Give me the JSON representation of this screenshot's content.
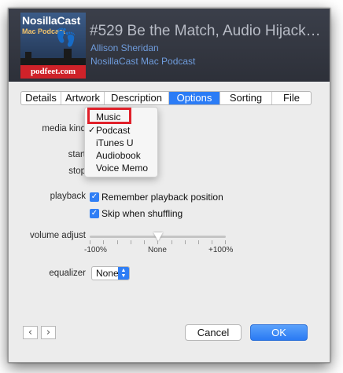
{
  "header": {
    "artwork": {
      "title": "NosillaCast",
      "subtitle": "Mac Podcast",
      "url": "podfeet.com",
      "feet_icon": "footprints"
    },
    "episode_title": "#529 Be the Match, Audio Hijack…",
    "artist": "Allison Sheridan",
    "album": "NosillaCast Mac Podcast"
  },
  "tabs": [
    {
      "label": "Details",
      "selected": false
    },
    {
      "label": "Artwork",
      "selected": false
    },
    {
      "label": "Description",
      "selected": false
    },
    {
      "label": "Options",
      "selected": true
    },
    {
      "label": "Sorting",
      "selected": false
    },
    {
      "label": "File",
      "selected": false
    }
  ],
  "options": {
    "media_kind_label": "media kind",
    "start_label": "start",
    "stop_label": "stop",
    "playback_label": "playback",
    "remember_label": "Remember playback position",
    "remember_checked": true,
    "skip_label": "Skip when shuffling",
    "skip_checked": true,
    "volume_label": "volume adjust",
    "volume_value": 0,
    "volume_min_label": "-100%",
    "volume_mid_label": "None",
    "volume_max_label": "+100%",
    "equalizer_label": "equalizer",
    "equalizer_value": "None"
  },
  "menu": {
    "items": [
      {
        "label": "Music",
        "checked": false,
        "highlighted": true
      },
      {
        "label": "Podcast",
        "checked": true,
        "highlighted": false
      },
      {
        "label": "iTunes U",
        "checked": false,
        "highlighted": false
      },
      {
        "label": "Audiobook",
        "checked": false,
        "highlighted": false
      },
      {
        "label": "Voice Memo",
        "checked": false,
        "highlighted": false
      }
    ],
    "check_glyph": "✓"
  },
  "footer": {
    "prev_glyph": "‹",
    "next_glyph": "›",
    "cancel_label": "Cancel",
    "ok_label": "OK"
  },
  "colors": {
    "accent": "#2b7cf6",
    "highlight_box": "#e0202a",
    "link": "#6f9cdc"
  }
}
